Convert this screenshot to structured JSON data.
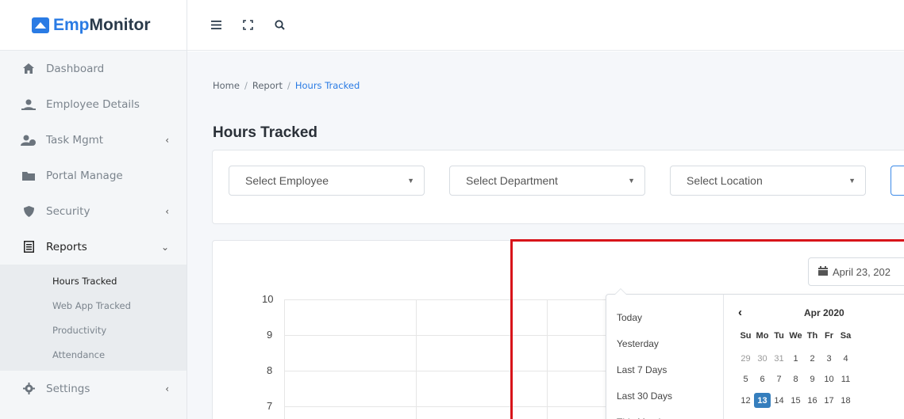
{
  "brand": {
    "part1": "Emp",
    "part2": "Monitor"
  },
  "sidebar": {
    "items": [
      {
        "label": "Dashboard",
        "icon": "home-icon"
      },
      {
        "label": "Employee Details",
        "icon": "users-icon"
      },
      {
        "label": "Task Mgmt",
        "icon": "user-task-icon",
        "has_caret": true
      },
      {
        "label": "Portal Manage",
        "icon": "folder-icon"
      },
      {
        "label": "Security",
        "icon": "shield-icon",
        "has_caret": true
      },
      {
        "label": "Reports",
        "icon": "report-icon",
        "expanded": true
      },
      {
        "label": "Settings",
        "icon": "gear-icon",
        "has_caret": true
      }
    ],
    "reports_sub": [
      "Hours Tracked",
      "Web App Tracked",
      "Productivity",
      "Attendance"
    ]
  },
  "topbar": {
    "icons": [
      "menu-icon",
      "fullscreen-icon",
      "search-icon"
    ]
  },
  "breadcrumb": {
    "home": "Home",
    "report": "Report",
    "current": "Hours Tracked",
    "sep": "/"
  },
  "page_title": "Hours Tracked",
  "filters": {
    "employee": "Select Employee",
    "department": "Select Department",
    "location": "Select Location"
  },
  "date_input": {
    "value": "April 23, 202"
  },
  "chart_data": {
    "type": "bar",
    "y_ticks": [
      "10",
      "9",
      "8",
      "7"
    ]
  },
  "date_ranges": [
    "Today",
    "Yesterday",
    "Last 7 Days",
    "Last 30 Days",
    "This Month"
  ],
  "calendar": {
    "month": "Apr 2020",
    "prev": "‹",
    "dow": [
      "Su",
      "Mo",
      "Tu",
      "We",
      "Th",
      "Fr",
      "Sa"
    ],
    "weeks": [
      [
        "29",
        "30",
        "31",
        "1",
        "2",
        "3",
        "4"
      ],
      [
        "5",
        "6",
        "7",
        "8",
        "9",
        "10",
        "11"
      ],
      [
        "12",
        "13",
        "14",
        "15",
        "16",
        "17",
        "18"
      ]
    ],
    "selected": "13"
  },
  "colors": {
    "accent": "#2a7be4",
    "highlight": "#d8141a",
    "selected": "#357ebd"
  }
}
